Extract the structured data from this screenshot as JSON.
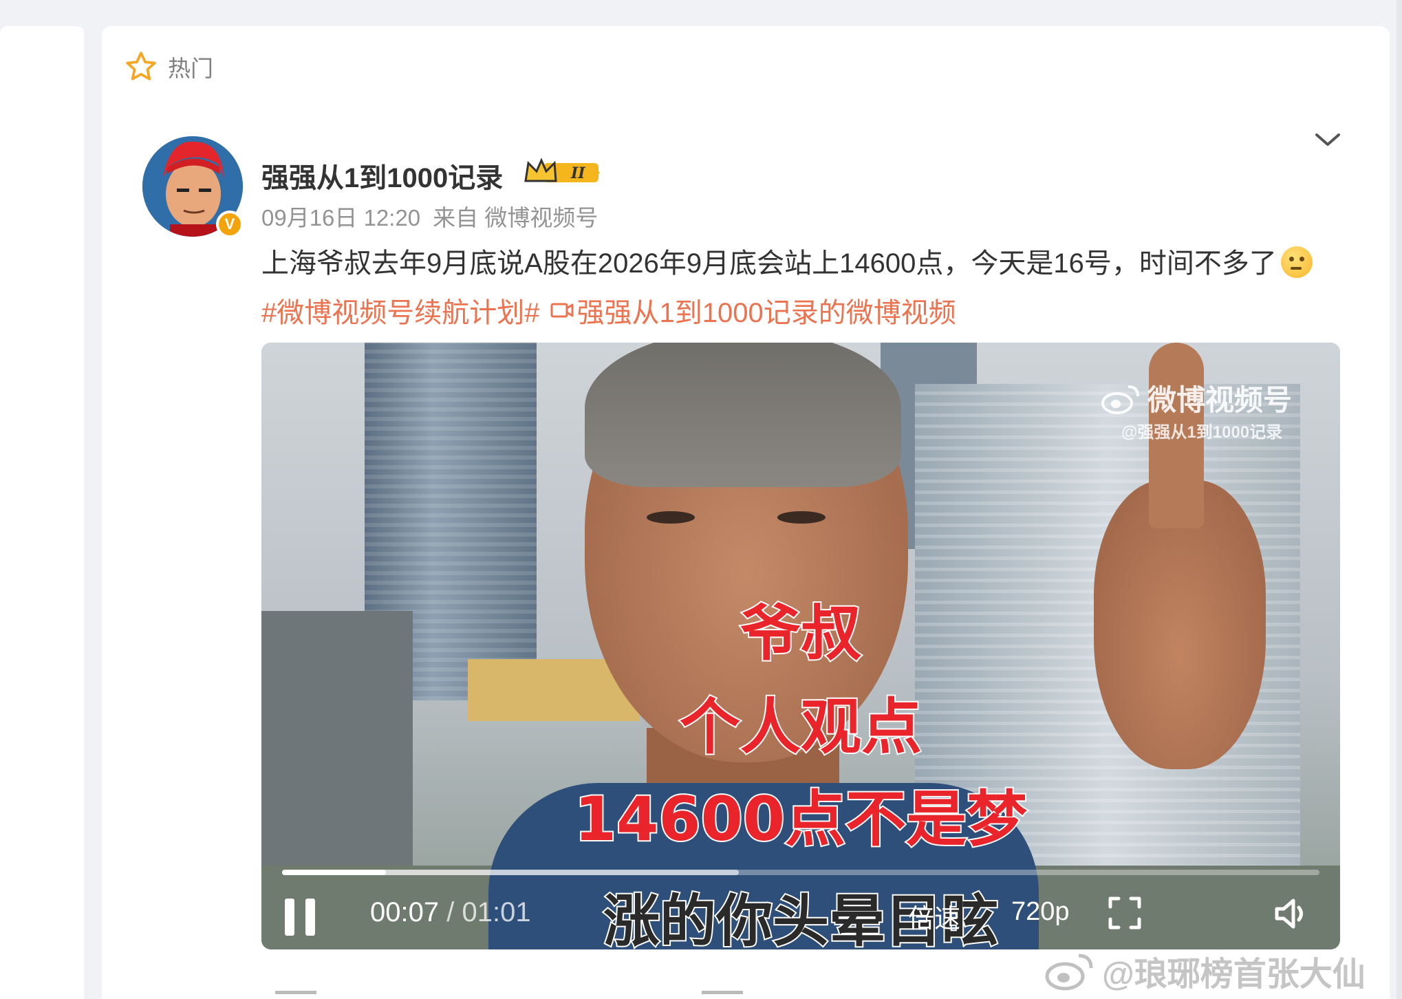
{
  "section": {
    "label": "热门"
  },
  "post": {
    "username": "强强从1到1000记录",
    "date": "09月16日 12:20",
    "source": "来自 微博视频号",
    "text": "上海爷叔去年9月底说A股在2026年9月底会站上14600点，今天是16号，时间不多了",
    "topic_tag": "#微博视频号续航计划#",
    "video_link": "强强从1到1000记录的微博视频"
  },
  "video": {
    "captions": [
      "爷叔",
      "个人观点",
      "14600点不是梦",
      "涨的你头晕目眩"
    ],
    "watermark_title": "微博视频号",
    "watermark_handle": "@强强从1到1000记录",
    "current_time": "00:07",
    "duration": "/ 01:01",
    "speed_label": "倍速",
    "quality_label": "720p",
    "played_fraction": 0.1,
    "buffered_fraction": 0.44
  },
  "page_watermark": "@琅琊榜首张大仙",
  "colors": {
    "accent": "#eb7350",
    "badge": "#f3a40d",
    "caption_red": "#e9242a"
  },
  "icons": [
    "star-icon",
    "verified-icon",
    "crown-badge-icon",
    "chevron-down-icon",
    "video-link-icon",
    "weibo-logo-icon",
    "pause-icon",
    "fullscreen-icon",
    "volume-icon"
  ]
}
